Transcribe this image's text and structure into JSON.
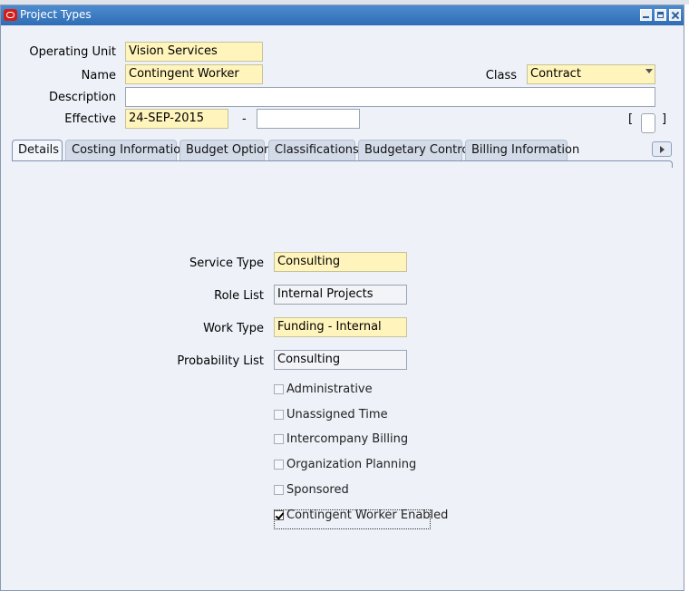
{
  "window": {
    "title": "Project Types"
  },
  "header": {
    "operating_unit_label": "Operating Unit",
    "operating_unit_value": "Vision Services",
    "name_label": "Name",
    "name_value": "Contingent Worker",
    "class_label": "Class",
    "class_value": "Contract",
    "description_label": "Description",
    "description_value": "",
    "effective_label": "Effective",
    "effective_from": "24-SEP-2015",
    "effective_sep": "-",
    "effective_to": "",
    "bracket_open": "[",
    "bracket_close": "]"
  },
  "tabs": [
    {
      "label": "Details",
      "active": true
    },
    {
      "label": "Costing Information",
      "active": false
    },
    {
      "label": "Budget Option",
      "active": false
    },
    {
      "label": "Classifications",
      "active": false
    },
    {
      "label": "Budgetary Control",
      "active": false
    },
    {
      "label": "Billing Information",
      "active": false
    }
  ],
  "details": {
    "service_type_label": "Service Type",
    "service_type_value": "Consulting",
    "role_list_label": "Role List",
    "role_list_value": "Internal Projects",
    "work_type_label": "Work Type",
    "work_type_value": "Funding - Internal",
    "probability_list_label": "Probability List",
    "probability_list_value": "Consulting",
    "checkboxes": [
      {
        "label": "Administrative",
        "checked": false
      },
      {
        "label": "Unassigned Time",
        "checked": false
      },
      {
        "label": "Intercompany Billing",
        "checked": false
      },
      {
        "label": "Organization Planning",
        "checked": false
      },
      {
        "label": "Sponsored",
        "checked": false
      },
      {
        "label": "Contingent Worker Enabled",
        "checked": true
      }
    ]
  },
  "colors": {
    "titlebar": "#2f6db5",
    "required_field": "#fff4bb",
    "window_bg": "#eef1f8"
  }
}
